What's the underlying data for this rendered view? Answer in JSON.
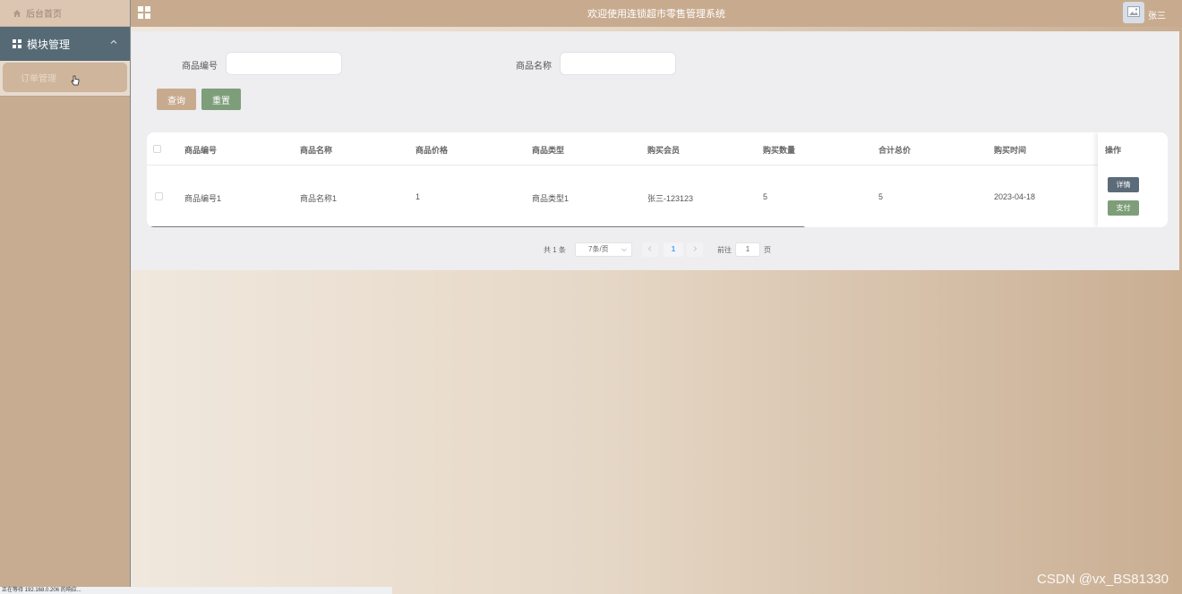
{
  "sidebar": {
    "home_label": "后台首页",
    "module_label": "模块管理",
    "sub_item_label": "订单管理"
  },
  "header": {
    "title": "欢迎使用连锁超市零售管理系统",
    "username": "张三"
  },
  "search": {
    "field1_label": "商品编号",
    "field1_value": "",
    "field2_label": "商品名称",
    "field2_value": "",
    "query_button": "查询",
    "reset_button": "重置"
  },
  "table": {
    "columns": [
      "商品编号",
      "商品名称",
      "商品价格",
      "商品类型",
      "购买会员",
      "购买数量",
      "合计总价",
      "购买时间",
      "操作"
    ],
    "rows": [
      [
        "商品编号1",
        "商品名称1",
        "1",
        "商品类型1",
        "张三-123123",
        "5",
        "5",
        "2023-04-18"
      ]
    ],
    "detail_button": "详情",
    "pay_button": "支付"
  },
  "pagination": {
    "total_text": "共 1 条",
    "page_size": "7条/页",
    "current_page": "1",
    "goto_prefix": "前往",
    "goto_value": "1",
    "goto_suffix": "页"
  },
  "watermark": "CSDN @vx_BS81330",
  "statusbar": "正在等待 192.168.0.206 的响应..."
}
